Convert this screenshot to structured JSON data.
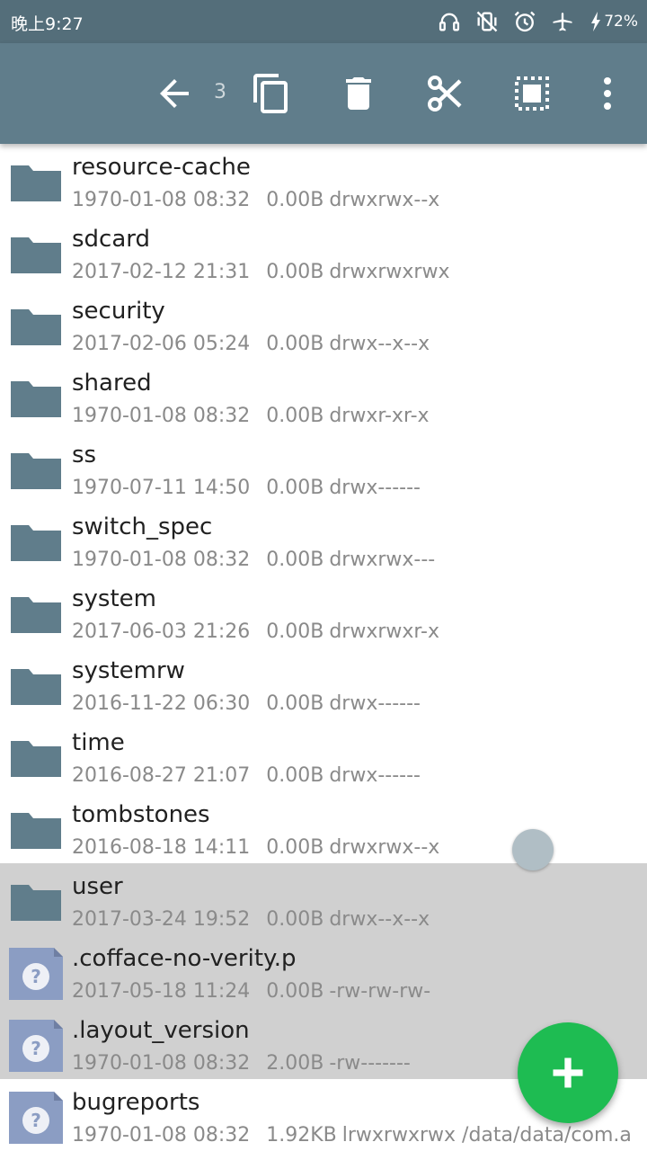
{
  "status_bar": {
    "time": "晚上9:27",
    "battery": "72%",
    "icons": [
      "headset-icon",
      "vibrate-off-icon",
      "alarm-icon",
      "airplane-icon",
      "charging-icon"
    ]
  },
  "toolbar": {
    "selected_count": "3",
    "actions": [
      "back-icon",
      "copy-icon",
      "delete-icon",
      "cut-icon",
      "select-all-icon",
      "more-icon"
    ]
  },
  "partial_row": {
    "meta": "2017-06-03 21:26   0.00B drwx"
  },
  "files": [
    {
      "name": "resource-cache",
      "date": "1970-01-08 08:32",
      "size": "0.00B",
      "perms": "drwxrwx--x",
      "type": "folder",
      "selected": false
    },
    {
      "name": "sdcard",
      "date": "2017-02-12 21:31",
      "size": "0.00B",
      "perms": "drwxrwxrwx",
      "type": "folder",
      "selected": false
    },
    {
      "name": "security",
      "date": "2017-02-06 05:24",
      "size": "0.00B",
      "perms": "drwx--x--x",
      "type": "folder",
      "selected": false
    },
    {
      "name": "shared",
      "date": "1970-01-08 08:32",
      "size": "0.00B",
      "perms": "drwxr-xr-x",
      "type": "folder",
      "selected": false
    },
    {
      "name": "ss",
      "date": "1970-07-11 14:50",
      "size": "0.00B",
      "perms": "drwx------",
      "type": "folder",
      "selected": false
    },
    {
      "name": "switch_spec",
      "date": "1970-01-08 08:32",
      "size": "0.00B",
      "perms": "drwxrwx---",
      "type": "folder",
      "selected": false
    },
    {
      "name": "system",
      "date": "2017-06-03 21:26",
      "size": "0.00B",
      "perms": "drwxrwxr-x",
      "type": "folder",
      "selected": false
    },
    {
      "name": "systemrw",
      "date": "2016-11-22 06:30",
      "size": "0.00B",
      "perms": "drwx------",
      "type": "folder",
      "selected": false
    },
    {
      "name": "time",
      "date": "2016-08-27 21:07",
      "size": "0.00B",
      "perms": "drwx------",
      "type": "folder",
      "selected": false
    },
    {
      "name": "tombstones",
      "date": "2016-08-18 14:11",
      "size": "0.00B",
      "perms": "drwxrwx--x",
      "type": "folder",
      "selected": false
    },
    {
      "name": "user",
      "date": "2017-03-24 19:52",
      "size": "0.00B",
      "perms": "drwx--x--x",
      "type": "folder",
      "selected": true
    },
    {
      "name": ".cofface-no-verity.p",
      "date": "2017-05-18 11:24",
      "size": "0.00B",
      "perms": "-rw-rw-rw-",
      "type": "file",
      "selected": true
    },
    {
      "name": ".layout_version",
      "date": "1970-01-08 08:32",
      "size": "2.00B",
      "perms": "-rw-------",
      "type": "file",
      "selected": true
    },
    {
      "name": "bugreports",
      "date": "1970-01-08 08:32",
      "size": "1.92KB",
      "perms": "lrwxrwxrwx /data/data/com.a",
      "type": "file",
      "selected": false
    }
  ],
  "colors": {
    "status_bar": "#546e7a",
    "toolbar": "#607d8b",
    "folder": "#607d8b",
    "file": "#8b9dc3",
    "selected_row": "#d0d0d0",
    "fab": "#1ebc52"
  },
  "fab": {
    "icon": "plus-icon"
  }
}
